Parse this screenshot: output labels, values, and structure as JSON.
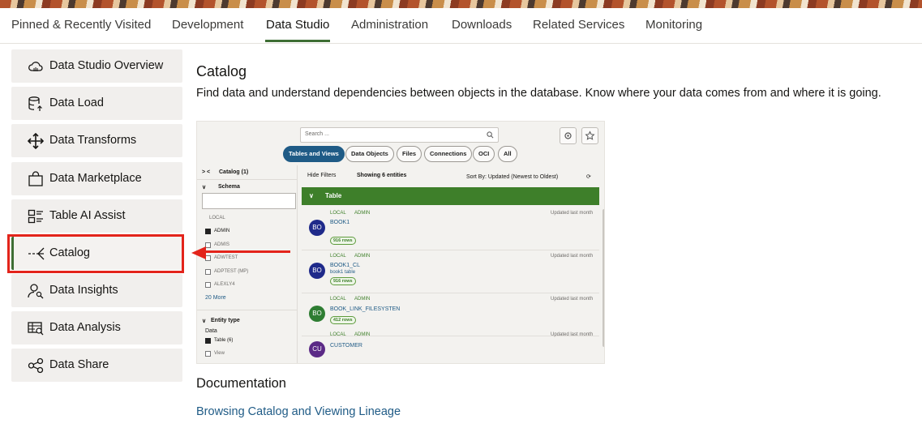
{
  "tabs": [
    {
      "label": "Pinned & Recently Visited"
    },
    {
      "label": "Development"
    },
    {
      "label": "Data Studio"
    },
    {
      "label": "Administration"
    },
    {
      "label": "Downloads"
    },
    {
      "label": "Related Services"
    },
    {
      "label": "Monitoring"
    }
  ],
  "active_tab": "Data Studio",
  "sidebar": {
    "items": [
      {
        "label": "Data Studio Overview",
        "icon": "cloud-icon"
      },
      {
        "label": "Data Load",
        "icon": "database-upload-icon"
      },
      {
        "label": "Data Transforms",
        "icon": "move-arrows-icon"
      },
      {
        "label": "Data Marketplace",
        "icon": "shopping-bag-icon"
      },
      {
        "label": "Table AI Assist",
        "icon": "table-list-icon"
      },
      {
        "label": "Catalog",
        "icon": "catalog-icon"
      },
      {
        "label": "Data Insights",
        "icon": "user-search-icon"
      },
      {
        "label": "Data Analysis",
        "icon": "table-search-icon"
      },
      {
        "label": "Data Share",
        "icon": "share-icon"
      }
    ],
    "selected": "Catalog"
  },
  "main": {
    "title": "Catalog",
    "description": "Find data and understand dependencies between objects in the database. Know where your data comes from and where it is going.",
    "documentation_title": "Documentation",
    "documentation_link": "Browsing Catalog and Viewing Lineage"
  },
  "preview": {
    "search_placeholder": "Search ...",
    "filter_tabs": [
      "Tables and Views",
      "Data Objects",
      "Files",
      "Connections",
      "OCI",
      "All"
    ],
    "active_filter": "Tables and Views",
    "catalog_label": "Catalog (1)",
    "schema_label": "Schema",
    "local_label": "LOCAL",
    "schemas": [
      {
        "name": "ADMIN",
        "checked": true
      },
      {
        "name": "ADMIS",
        "checked": false
      },
      {
        "name": "ADWTEST",
        "checked": false
      },
      {
        "name": "ADPTEST (MP)",
        "checked": false
      },
      {
        "name": "ALEXLY4",
        "checked": false
      }
    ],
    "more_link": "20 More",
    "entity_type_label": "Entity type",
    "data_label": "Data",
    "entity_types": [
      {
        "name": "Table (6)",
        "checked": true
      },
      {
        "name": "View",
        "checked": false
      }
    ],
    "hide_filters": "Hide Filters",
    "showing": "Showing 6 entities",
    "sort_by": "Sort By: Updated (Newest to Oldest)",
    "group_header": "Table",
    "entities": [
      {
        "initials": "BO",
        "name": "BOOK1",
        "source": "LOCAL",
        "owner": "ADMIN",
        "updated": "Updated last month",
        "subtitle": "",
        "rows": "916 rows",
        "color": "#1f2a8a"
      },
      {
        "initials": "BO",
        "name": "BOOK1_CL",
        "source": "LOCAL",
        "owner": "ADMIN",
        "updated": "Updated last month",
        "subtitle": "book1 table",
        "rows": "916 rows",
        "color": "#1f2a8a"
      },
      {
        "initials": "BO",
        "name": "BOOK_LINK_FILESYSTEN",
        "source": "LOCAL",
        "owner": "ADMIN",
        "updated": "Updated last month",
        "subtitle": "",
        "rows": "412 rows",
        "color": "#2e7d32"
      },
      {
        "initials": "CU",
        "name": "CUSTOMER",
        "source": "LOCAL",
        "owner": "ADMIN",
        "updated": "Updated last month",
        "subtitle": "",
        "rows": "",
        "color": "#5b2a86"
      }
    ]
  },
  "colors": {
    "accent": "#3e6e34",
    "link": "#1f5b86",
    "highlight": "#e3241b"
  }
}
